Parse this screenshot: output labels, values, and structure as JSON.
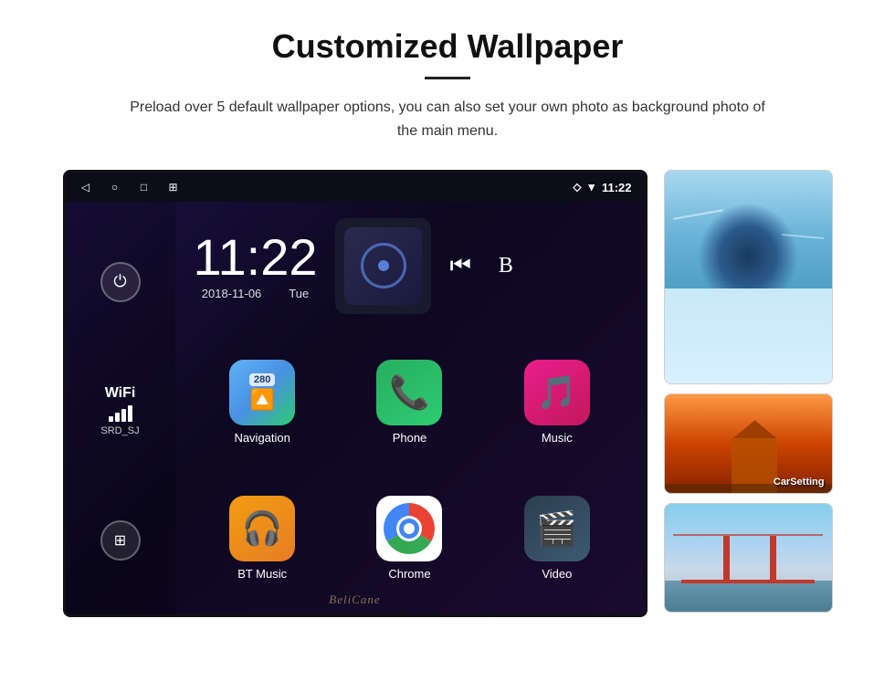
{
  "header": {
    "title": "Customized Wallpaper",
    "subtitle": "Preload over 5 default wallpaper options, you can also set your own photo as background photo of the main menu."
  },
  "android": {
    "status_bar": {
      "time": "11:22",
      "nav_icons": [
        "back",
        "home",
        "recents",
        "screenshot"
      ],
      "right_icons": [
        "location",
        "signal",
        "time"
      ]
    },
    "clock": {
      "time": "11:22",
      "date": "2018-11-06",
      "day": "Tue"
    },
    "wifi": {
      "label": "WiFi",
      "ssid": "SRD_SJ"
    },
    "apps": [
      {
        "label": "Navigation",
        "type": "navigation"
      },
      {
        "label": "Phone",
        "type": "phone"
      },
      {
        "label": "Music",
        "type": "music"
      },
      {
        "label": "BT Music",
        "type": "btmusic"
      },
      {
        "label": "Chrome",
        "type": "chrome"
      },
      {
        "label": "Video",
        "type": "video"
      }
    ],
    "nav_number": "280",
    "media_controls": [
      "prev",
      "bluetooth"
    ],
    "watermark": "BeliCane"
  },
  "wallpapers": [
    {
      "name": "ice-cave",
      "description": "Ice cave blue wallpaper"
    },
    {
      "name": "golden-gate",
      "description": "Golden Gate Bridge wallpaper"
    }
  ]
}
